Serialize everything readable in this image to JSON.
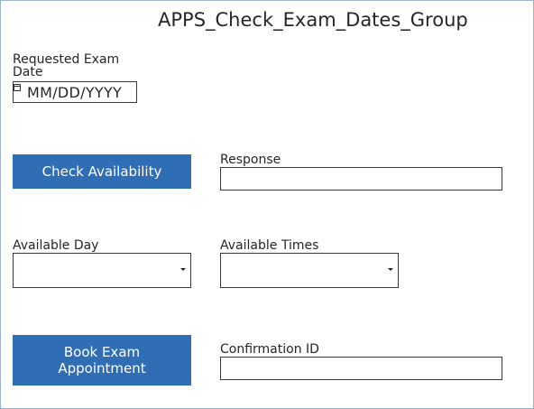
{
  "title": "APPS_Check_Exam_Dates_Group",
  "requested_date": {
    "label": "Requested Exam Date",
    "placeholder": "MM/DD/YYYY",
    "icon": "calendar-icon"
  },
  "check_button": {
    "label": "Check Availability"
  },
  "response": {
    "label": "Response",
    "value": ""
  },
  "available_day": {
    "label": "Available Day",
    "selected": ""
  },
  "available_times": {
    "label": "Available Times",
    "selected": ""
  },
  "book_button": {
    "label": "Book Exam Appointment"
  },
  "confirmation": {
    "label": "Confirmation ID",
    "value": ""
  },
  "colors": {
    "button_bg": "#2f6db5",
    "button_text": "#ffffff",
    "frame_border": "#9bb3d0"
  }
}
